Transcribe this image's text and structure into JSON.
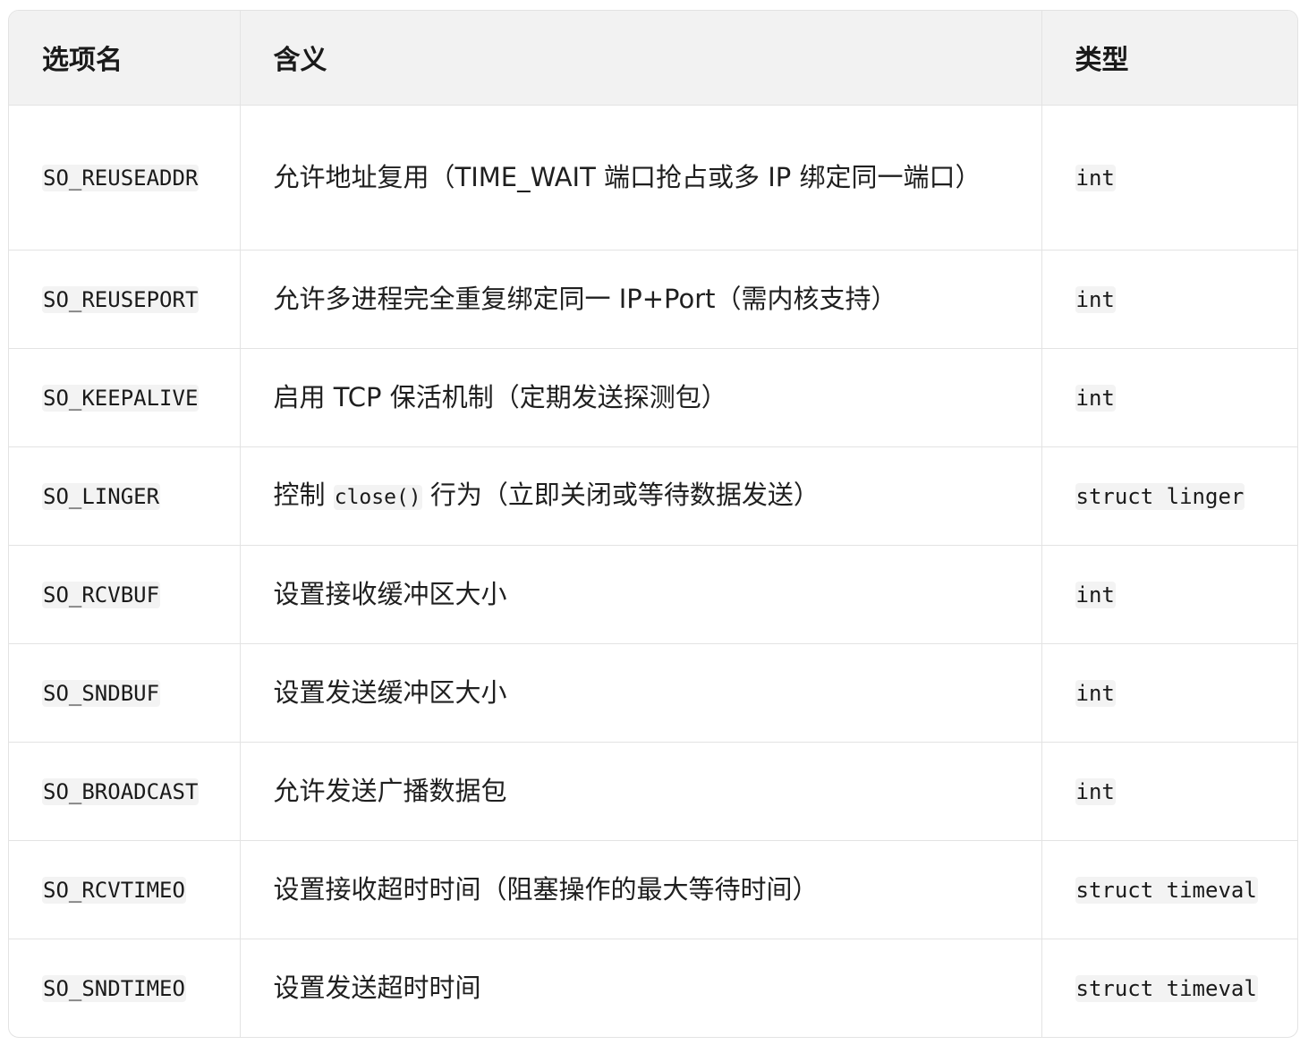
{
  "headers": {
    "option": "选项名",
    "meaning": "含义",
    "type": "类型"
  },
  "rows": [
    {
      "option": "SO_REUSEADDR",
      "meaning": "允许地址复用（TIME_WAIT 端口抢占或多 IP 绑定同一端口）",
      "type": "int"
    },
    {
      "option": "SO_REUSEPORT",
      "meaning": "允许多进程完全重复绑定同一 IP+Port（需内核支持）",
      "type": "int"
    },
    {
      "option": "SO_KEEPALIVE",
      "meaning": "启用 TCP 保活机制（定期发送探测包）",
      "type": "int"
    },
    {
      "option": "SO_LINGER",
      "meaning_before": "控制 ",
      "meaning_code": "close()",
      "meaning_after": " 行为（立即关闭或等待数据发送）",
      "type": "struct linger"
    },
    {
      "option": "SO_RCVBUF",
      "meaning": "设置接收缓冲区大小",
      "type": "int"
    },
    {
      "option": "SO_SNDBUF",
      "meaning": "设置发送缓冲区大小",
      "type": "int"
    },
    {
      "option": "SO_BROADCAST",
      "meaning": "允许发送广播数据包",
      "type": "int"
    },
    {
      "option": "SO_RCVTIMEO",
      "meaning": "设置接收超时时间（阻塞操作的最大等待时间）",
      "type": "struct timeval"
    },
    {
      "option": "SO_SNDTIMEO",
      "meaning": "设置发送超时时间",
      "type": "struct timeval"
    }
  ]
}
